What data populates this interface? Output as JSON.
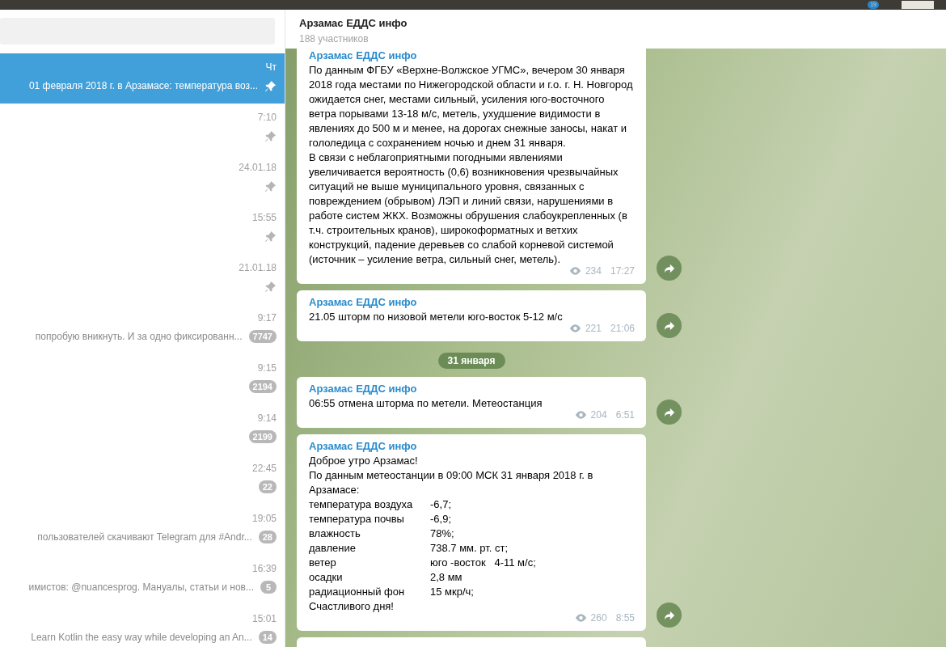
{
  "system_bar": {
    "tray_badge": "19"
  },
  "chats": [
    {
      "time": "Чт",
      "preview": "01 февраля 2018 г. в Арзамасе: температура воз...",
      "pinned": true,
      "selected": true
    },
    {
      "time": "7:10",
      "pinned": true,
      "selected": false
    },
    {
      "time": "24.01.18",
      "pinned": true,
      "selected": false
    },
    {
      "time": "15:55",
      "pinned": true,
      "selected": false
    },
    {
      "time": "21.01.18",
      "pinned": true,
      "selected": false
    },
    {
      "time": "9:17",
      "preview": "попробую вникнуть. И за одно фиксированн...",
      "pinned": false,
      "badge": "7747",
      "selected": false
    },
    {
      "time": "9:15",
      "pinned": false,
      "badge": "2194",
      "selected": false
    },
    {
      "time": "9:14",
      "pinned": false,
      "badge": "2199",
      "selected": false
    },
    {
      "time": "22:45",
      "pinned": false,
      "badge": "22",
      "selected": false
    },
    {
      "time": "19:05",
      "preview": "пользователей скачивают Telegram для #Andr...",
      "pinned": false,
      "badge": "28",
      "selected": false
    },
    {
      "time": "16:39",
      "preview": "имистов: @nuancesprog.  Мануалы, статьи и нов...",
      "pinned": false,
      "badge": "5",
      "selected": false
    },
    {
      "time": "15:01",
      "preview": "Learn Kotlin the easy way while developing an An...",
      "pinned": false,
      "badge": "14",
      "selected": false
    }
  ],
  "header": {
    "title": "Арзамас ЕДДС инфо",
    "subtitle": "188 участников"
  },
  "feed": [
    {
      "kind": "message",
      "sender": "Арзамас ЕДДС инфо",
      "paragraphs": [
        "По данным ФГБУ «Верхне-Волжское УГМС», вечером 30 января 2018 года местами по Нижегородской области и г.о. г. Н. Новгород ожидается снег, местами сильный, усиления юго-восточного ветра порывами 13-18 м/с, метель, ухудшение видимости в явлениях до 500 м и менее, на дорогах снежные заносы, накат и гололедица с сохранением ночью и днем 31 января.",
        "В связи с неблагоприятными погодными явлениями увеличивается вероятность (0,6) возникновения чрезвычайных ситуаций не выше муниципального уровня, связанных с повреждением (обрывом) ЛЭП и линий связи, нарушениями в работе систем ЖКХ. Возможны обрушения слабоукрепленных (в т.ч. строительных кранов), широкоформатных и ветхих конструкций, падение деревьев со слабой корневой системой (источник – усиление ветра, сильный снег, метель)."
      ],
      "views": "234",
      "time": "17:27"
    },
    {
      "kind": "message",
      "sender": "Арзамас ЕДДС инфо",
      "paragraphs": [
        "21.05 шторм по низовой метели юго-восток 5-12 м/с"
      ],
      "views": "221",
      "time": "21:06"
    },
    {
      "kind": "date",
      "label": "31 января"
    },
    {
      "kind": "message",
      "sender": "Арзамас ЕДДС инфо",
      "paragraphs": [
        "06:55 отмена шторма по метели. Метеостанция"
      ],
      "views": "204",
      "time": "6:51"
    },
    {
      "kind": "message",
      "sender": "Арзамас ЕДДС инфо",
      "paragraphs": [
        "Доброе утро Арзамас!",
        "По данным метеостанции в 09:00 МСК 31 января 2018 г. в Арзамасе:"
      ],
      "table": [
        {
          "label": "температура воздуха",
          "value": "-6,7;"
        },
        {
          "label": "температура почвы",
          "value": "-6,9;"
        },
        {
          "label": "влажность",
          "value": "78%;"
        },
        {
          "label": "давление",
          "value": "738.7 мм. рт. ст;"
        },
        {
          "label": "ветер",
          "value": "юго -восток   4-11 м/с;"
        },
        {
          "label": "осадки",
          "value": "2,8 мм"
        },
        {
          "label": "радиационный фон",
          "value": "15 мкр/ч;"
        }
      ],
      "closing": "Счастливого дня!",
      "views": "260",
      "time": "8:55"
    },
    {
      "kind": "stub"
    }
  ]
}
